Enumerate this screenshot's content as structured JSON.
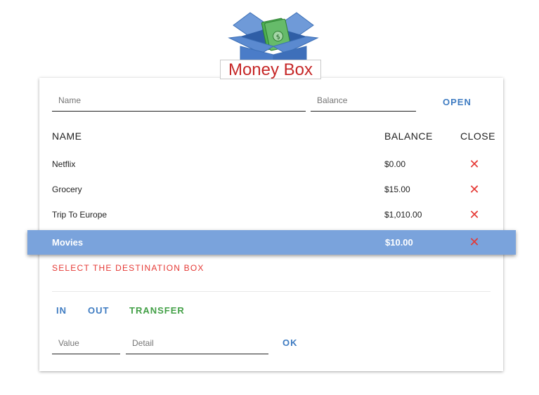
{
  "app": {
    "title": "Money Box"
  },
  "open_form": {
    "name_placeholder": "Name",
    "balance_placeholder": "Balance",
    "open_label": "OPEN"
  },
  "table": {
    "headers": {
      "name": "NAME",
      "balance": "BALANCE",
      "close": "CLOSE"
    },
    "rows": [
      {
        "name": "Netflix",
        "balance": "$0.00"
      },
      {
        "name": "Grocery",
        "balance": "$15.00"
      },
      {
        "name": "Trip To Europe",
        "balance": "$1,010.00"
      },
      {
        "name": "Movies",
        "balance": "$10.00",
        "selected": true
      }
    ],
    "close_icon": "close-x-icon"
  },
  "transfer": {
    "message": "SELECT THE DESTINATION BOX",
    "tabs": {
      "in": "IN",
      "out": "OUT",
      "transfer": "TRANSFER"
    },
    "value_placeholder": "Value",
    "detail_placeholder": "Detail",
    "ok_label": "OK"
  },
  "colors": {
    "accent_blue": "#3f7cc2",
    "selected_row": "#7aa3dc",
    "transfer_green": "#43a047",
    "error_red": "#e53935",
    "logo_red": "#c62828"
  }
}
